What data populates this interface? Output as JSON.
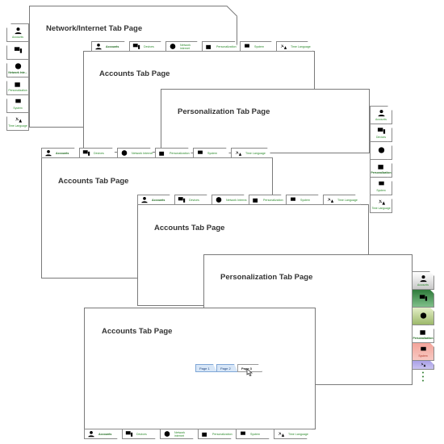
{
  "labels": {
    "accounts": "Accounts",
    "devices": "Devices",
    "network": "Network Internet",
    "network_short": "Network Inte...",
    "network_wrap": "Network\ninternet",
    "personalization": "Personalization",
    "system": "System",
    "time": "Time Language"
  },
  "panels": {
    "p1": "Network/Internet Tab Page",
    "p2": "Accounts Tab Page",
    "p3": "Personalization Tab Page",
    "p4": "Accounts Tab Page",
    "p5": "Accounts Tab Page",
    "p6": "Personalization Tab Page",
    "p7": "Accounts Tab Page"
  },
  "pages": [
    "Page 1",
    "Page 2",
    "Page 3"
  ],
  "colors": {
    "accent": "#2d7d2d",
    "page_tab": "#d7e6f7",
    "page_border": "#7fa6d6"
  },
  "icons": {
    "accounts": "person-icon",
    "devices": "devices-icon",
    "network": "globe-icon",
    "personalization": "brush-icon",
    "system": "laptop-icon",
    "time": "language-icon"
  }
}
